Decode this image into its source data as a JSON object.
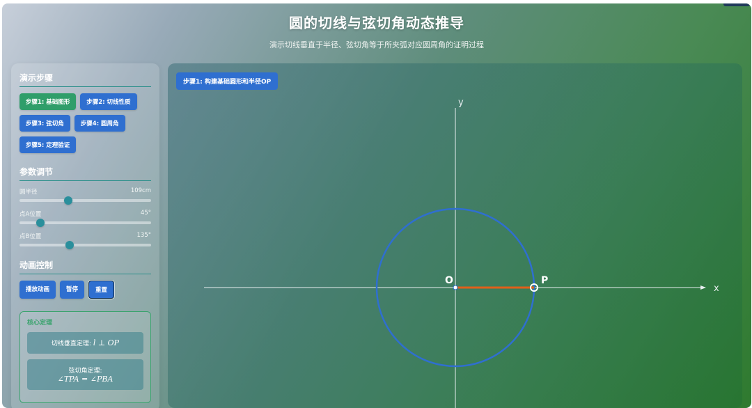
{
  "header": {
    "title": "圆的切线与弦切角动态推导",
    "subtitle": "演示切线垂直于半径、弦切角等于所夹弧对应圆周角的证明过程"
  },
  "sidebar": {
    "steps_title": "演示步骤",
    "steps": [
      {
        "label": "步骤1: 基础图形",
        "active": true
      },
      {
        "label": "步骤2: 切线性质",
        "active": false
      },
      {
        "label": "步骤3: 弦切角",
        "active": false
      },
      {
        "label": "步骤4: 圆周角",
        "active": false
      },
      {
        "label": "步骤5: 定理验证",
        "active": false
      }
    ],
    "params_title": "参数调节",
    "params": [
      {
        "label": "圆半径",
        "value": "109cm",
        "fraction": 0.37
      },
      {
        "label": "点A位置",
        "value": "45°",
        "fraction": 0.16
      },
      {
        "label": "点B位置",
        "value": "135°",
        "fraction": 0.38
      }
    ],
    "anim_title": "动画控制",
    "anim_buttons": {
      "play": "播放动画",
      "pause": "暂停",
      "reset": "重置"
    },
    "theorem": {
      "title": "核心定理",
      "tangent_label": "切线垂直定理:",
      "tangent_formula": "l ⊥ OP",
      "chord_label": "弦切角定理:",
      "chord_formula": "∠TPA = ∠PBA"
    }
  },
  "canvas": {
    "step_label": "步骤1: 构建基础圆形和半径OP",
    "axis_x_label": "x",
    "axis_y_label": "y",
    "center_label": "O",
    "point_label": "P",
    "colors": {
      "circle": "#2f6fd0",
      "radius": "#e0601a",
      "axis": "#e8eef0"
    }
  }
}
